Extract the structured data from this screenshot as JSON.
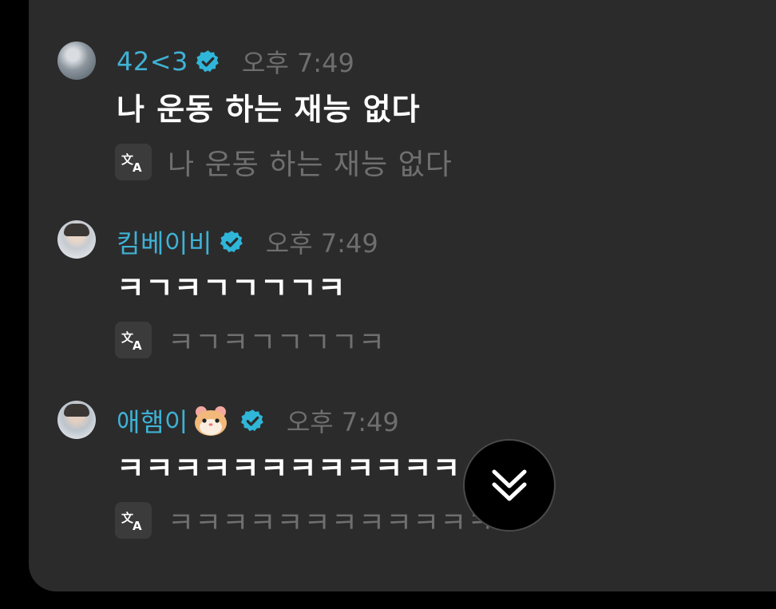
{
  "messages": [
    {
      "username": "42<3",
      "time": "오후 7:49",
      "text": "나 운동 하는 재능 없다",
      "translation": "나 운동 하는 재능 없다"
    },
    {
      "username": "킴베이비",
      "time": "오후 7:49",
      "text": "ㅋㄱㅋㄱㄱㄱㄱㅋ",
      "translation": "ㅋㄱㅋㄱㄱㄱㄱㅋ"
    },
    {
      "username": "애햄이",
      "username_emoji": "hamster-emoji",
      "time": "오후 7:49",
      "text": "ㅋㅋㅋㅋㅋㅋㅋㅋㅋㅋㅋㅋ",
      "translation": "ㅋㅋㅋㅋㅋㅋㅋㅋㅋㅋㅋㅋ"
    }
  ],
  "icons": {
    "verified": "verified-badge-icon",
    "translate": "translate-icon",
    "scroll": "chevron-double-down-icon"
  },
  "colors": {
    "username": "#3fb2d6",
    "verified_badge": "#2fb6d9",
    "background": "#2b2b2b",
    "time": "#6e6e6e",
    "translation_text": "#6f6f6f"
  }
}
